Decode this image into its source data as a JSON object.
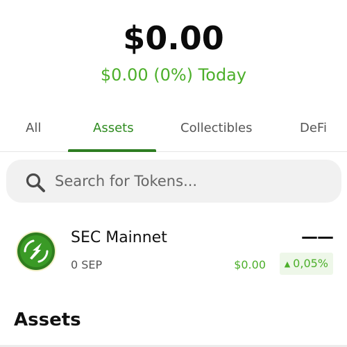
{
  "header": {
    "balance": "$0.00",
    "change": "$0.00 (0%) Today"
  },
  "tabs": [
    {
      "label": "All"
    },
    {
      "label": "Assets"
    },
    {
      "label": "Collectibles"
    },
    {
      "label": "DeFi"
    }
  ],
  "active_tab": "Assets",
  "search": {
    "placeholder": "Search for Tokens...",
    "value": ""
  },
  "tokens": [
    {
      "name": "SEC Mainnet",
      "balance": "0 SEP",
      "price_placeholder": "——",
      "fiat_value": "$0.00",
      "change": "0,05%",
      "change_direction": "up",
      "icon": "sec-mainnet-logo-icon"
    }
  ],
  "section": {
    "title": "Assets"
  },
  "colors": {
    "accent": "#2e7d22",
    "positive": "#4caf2a",
    "positive_bg": "#eef7e9",
    "search_bg": "#f1f1f1"
  }
}
